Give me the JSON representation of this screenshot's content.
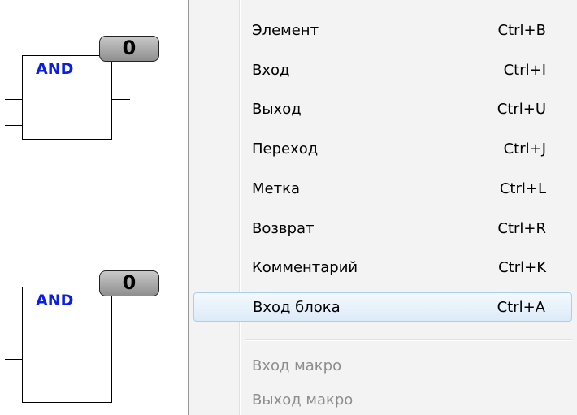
{
  "canvas": {
    "blocks": [
      {
        "title": "AND",
        "counter": "0"
      },
      {
        "title": "AND",
        "counter": "0"
      }
    ]
  },
  "context_menu": {
    "items": [
      {
        "label": "Элемент",
        "shortcut": "Ctrl+B",
        "enabled": true
      },
      {
        "label": "Вход",
        "shortcut": "Ctrl+I",
        "enabled": true
      },
      {
        "label": "Выход",
        "shortcut": "Ctrl+U",
        "enabled": true
      },
      {
        "label": "Переход",
        "shortcut": "Ctrl+J",
        "enabled": true
      },
      {
        "label": "Метка",
        "shortcut": "Ctrl+L",
        "enabled": true
      },
      {
        "label": "Возврат",
        "shortcut": "Ctrl+R",
        "enabled": true
      },
      {
        "label": "Комментарий",
        "shortcut": "Ctrl+K",
        "enabled": true
      },
      {
        "label": "Вход блока",
        "shortcut": "Ctrl+A",
        "enabled": true,
        "highlighted": true
      },
      {
        "label": "Вход макро",
        "shortcut": "",
        "enabled": false
      },
      {
        "label": "Выход макро",
        "shortcut": "",
        "enabled": false
      }
    ]
  },
  "colors": {
    "block_title": "#0a1ee6",
    "menu_background": "#f3f3f3",
    "menu_highlight": "#dcebf8",
    "disabled_text": "#8d8d8d"
  }
}
